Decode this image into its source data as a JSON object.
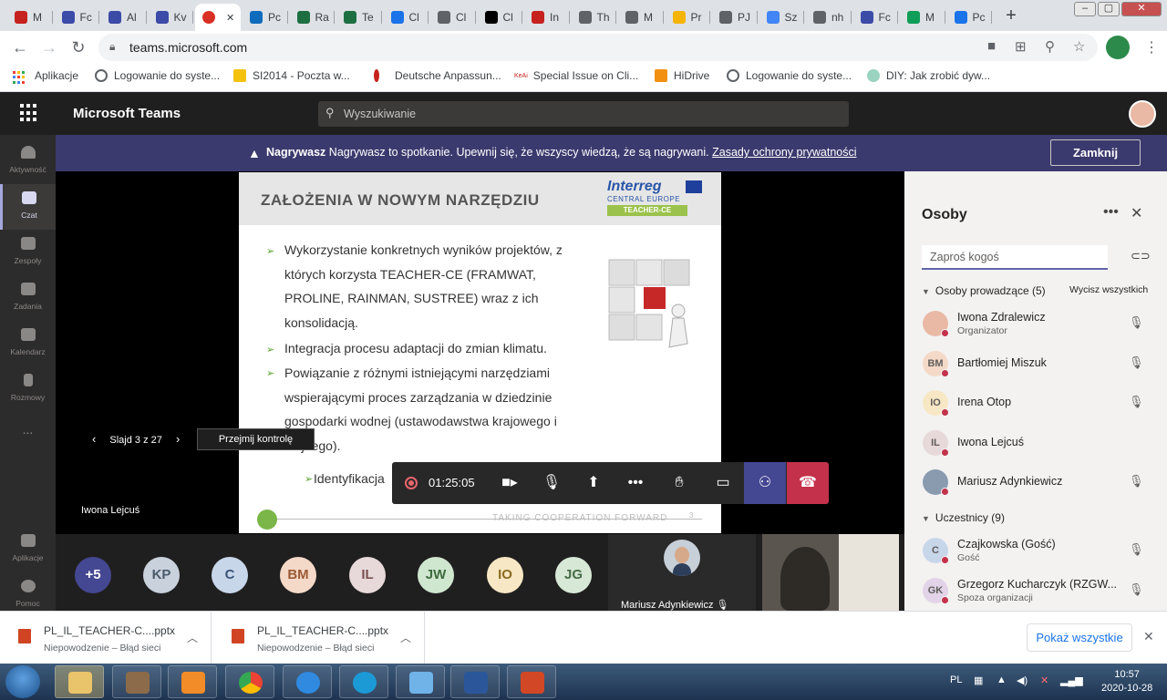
{
  "browser": {
    "tabs": [
      {
        "label": "M",
        "color": "#c5221f"
      },
      {
        "label": "Fc",
        "color": "#3c4ba8"
      },
      {
        "label": "Al",
        "color": "#3c4ba8"
      },
      {
        "label": "Kv",
        "color": "#3c4ba8"
      },
      {
        "label": "",
        "color": "#d93025",
        "active": true
      },
      {
        "label": "Pc",
        "color": "#0f6cbd"
      },
      {
        "label": "Ra",
        "color": "#1d6f42"
      },
      {
        "label": "Te",
        "color": "#1d6f42"
      },
      {
        "label": "Cl",
        "color": "#1a73e8"
      },
      {
        "label": "Cl",
        "color": "#5f6368"
      },
      {
        "label": "Cl",
        "color": "#000000"
      },
      {
        "label": "In",
        "color": "#c5221f"
      },
      {
        "label": "Th",
        "color": "#5f6368"
      },
      {
        "label": "M",
        "color": "#5f6368"
      },
      {
        "label": "Pr",
        "color": "#f4b400"
      },
      {
        "label": "PJ",
        "color": "#5f6368"
      },
      {
        "label": "Sz",
        "color": "#4285f4"
      },
      {
        "label": "nh",
        "color": "#5f6368"
      },
      {
        "label": "Fc",
        "color": "#3c4ba8"
      },
      {
        "label": "M",
        "color": "#0f9d58"
      },
      {
        "label": "Pc",
        "color": "#1a73e8"
      }
    ],
    "url": "teams.microsoft.com",
    "bookmarks": [
      "Aplikacje",
      "Logowanie do syste...",
      "SI2014 - Poczta w...",
      "Deutsche Anpassun...",
      "Special Issue on Cli...",
      "HiDrive",
      "Logowanie do syste...",
      "DIY: Jak zrobić dyw..."
    ],
    "bookmark_kea": "KeAi"
  },
  "teams": {
    "app_title": "Microsoft Teams",
    "search_placeholder": "Wyszukiwanie",
    "rail": [
      "Aktywność",
      "Czat",
      "Zespoły",
      "Zadania",
      "Kalendarz",
      "Rozmowy",
      "...",
      "Aplikacje",
      "Pomoc"
    ],
    "banner": {
      "bold": "Nagrywasz",
      "text": "Nagrywasz to spotkanie. Upewnij się, że wszyscy wiedzą, że są nagrywani.",
      "link": "Zasady ochrony prywatności",
      "close": "Zamknij"
    }
  },
  "slide": {
    "title": "ZAŁOŻENIA W NOWYM NARZĘDZIU",
    "logo_name": "Interreg",
    "logo_region": "CENTRAL EUROPE",
    "logo_project": "TEACHER-CE",
    "bullets": [
      "Wykorzystanie konkretnych wyników projektów, z których korzysta TEACHER-CE (FRAMWAT, PROLINE, RAINMAN, SUSTREE) wraz z ich konsolidacją.",
      "Integracja procesu adaptacji do zmian klimatu.",
      "Powiązanie z różnymi istniejącymi narzędziami wspierającymi proces zarządzania w dziedzinie gospodarki wodnej (ustawodawstwa krajowego i unijnego)."
    ],
    "sub_bullet": "Identyfikacja",
    "footer": "TAKING COOPERATION FORWARD",
    "page": "3"
  },
  "stage": {
    "slide_counter": "Slajd 3 z 27",
    "take_control": "Przejmij kontrolę",
    "presenter": "Iwona Lejcuś",
    "timer": "01:25:05"
  },
  "strip": {
    "avatars": [
      {
        "initials": "+5",
        "bg": "#444791",
        "fg": "#ffffff"
      },
      {
        "initials": "KP",
        "bg": "#c8d1dc",
        "fg": "#4a5a6a"
      },
      {
        "initials": "C",
        "bg": "#c8d6ea",
        "fg": "#3b5578"
      },
      {
        "initials": "BM",
        "bg": "#f5d9c8",
        "fg": "#9a5a35"
      },
      {
        "initials": "IL",
        "bg": "#e7d9d9",
        "fg": "#7a5151"
      },
      {
        "initials": "JW",
        "bg": "#cfe6cf",
        "fg": "#3e6b3e"
      },
      {
        "initials": "IO",
        "bg": "#f7e7c4",
        "fg": "#8a6a20"
      },
      {
        "initials": "JG",
        "bg": "#d7e8d7",
        "fg": "#466b46"
      }
    ],
    "tile_name": "Mariusz Adynkiewicz"
  },
  "people": {
    "title": "Osoby",
    "invite_placeholder": "Zaproś kogoś",
    "presenters_label": "Osoby prowadzące (5)",
    "mute_all": "Wycisz wszystkich",
    "presenters": [
      {
        "name": "Iwona Zdralewicz",
        "role": "Organizator",
        "initials": "",
        "bg": "#e9b9a5",
        "muted": true
      },
      {
        "name": "Bartłomiej Miszuk",
        "role": "",
        "initials": "BM",
        "bg": "#f5d9c8",
        "muted": true
      },
      {
        "name": "Irena Otop",
        "role": "",
        "initials": "IO",
        "bg": "#f7e7c4",
        "muted": true
      },
      {
        "name": "Iwona Lejcuś",
        "role": "",
        "initials": "IL",
        "bg": "#e7d9d9",
        "muted": false
      },
      {
        "name": "Mariusz Adynkiewicz",
        "role": "",
        "initials": "",
        "bg": "#8a9bb0",
        "muted": true
      }
    ],
    "attendees_label": "Uczestnicy (9)",
    "attendees": [
      {
        "name": "Czajkowska (Gość)",
        "role": "Gość",
        "initials": "C",
        "bg": "#c8d6ea",
        "muted": true
      },
      {
        "name": "Grzegorz Kucharczyk (RZGW...",
        "role": "Spoza organizacji",
        "initials": "GK",
        "bg": "#e2d3e8",
        "muted": true
      }
    ]
  },
  "downloads": {
    "items": [
      {
        "name": "PL_IL_TEACHER-C....pptx",
        "status": "Niepowodzenie – Błąd sieci"
      },
      {
        "name": "PL_IL_TEACHER-C....pptx",
        "status": "Niepowodzenie – Błąd sieci"
      }
    ],
    "show_all": "Pokaż wszystkie"
  },
  "taskbar": {
    "lang": "PL",
    "time": "10:57",
    "date": "2020-10-28"
  }
}
